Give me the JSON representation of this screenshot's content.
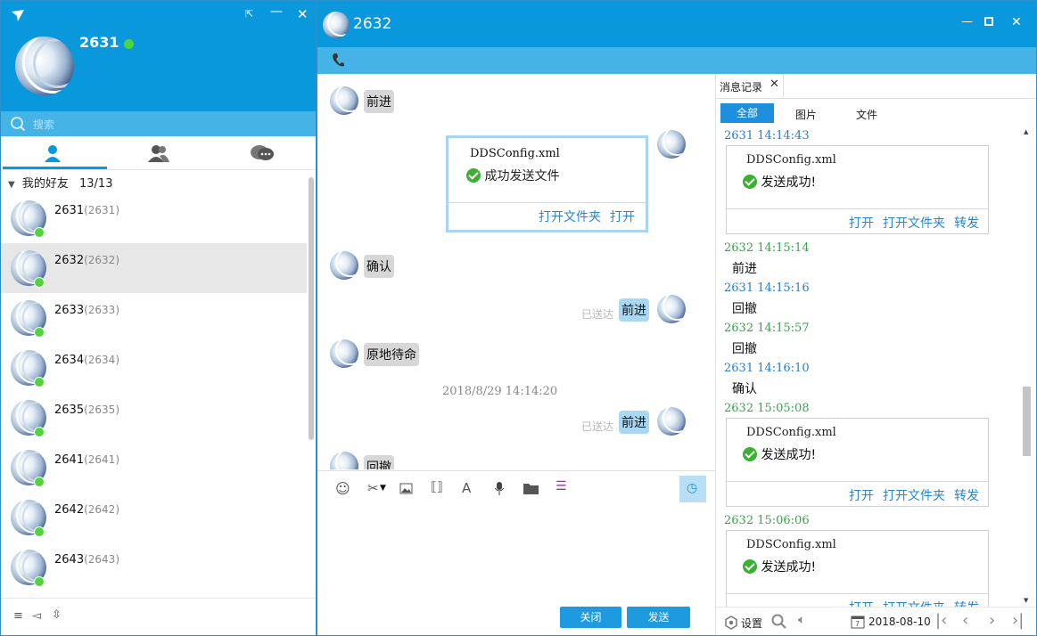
{
  "left": {
    "profile": {
      "name": "2631",
      "status_color": "#4fd43a"
    },
    "search": {
      "placeholder": "搜索"
    },
    "group": {
      "label": "我的好友",
      "count": "13/13"
    },
    "contacts": [
      {
        "name": "2631",
        "id": "(2631)"
      },
      {
        "name": "2632",
        "id": "(2632)"
      },
      {
        "name": "2633",
        "id": "(2633)"
      },
      {
        "name": "2634",
        "id": "(2634)"
      },
      {
        "name": "2635",
        "id": "(2635)"
      },
      {
        "name": "2641",
        "id": "(2641)"
      },
      {
        "name": "2642",
        "id": "(2642)"
      },
      {
        "name": "2643",
        "id": "(2643)"
      }
    ]
  },
  "chat": {
    "title": "2632",
    "messages": {
      "m1": "前进",
      "file_name": "DDSConfig.xml",
      "file_status": "成功发送文件",
      "open_folder": "打开文件夹",
      "open": "打开",
      "m2": "确认",
      "m3": "前进",
      "m3_status": "已送达",
      "m4": "原地待命",
      "time_sep": "2018/8/29 14:14:20",
      "m5": "前进",
      "m5_status": "已送达",
      "m6": "回撤"
    },
    "buttons": {
      "close": "关闭",
      "send": "发送"
    }
  },
  "history": {
    "tab_title": "消息记录",
    "filters": [
      "全部",
      "图片",
      "文件"
    ],
    "entries": {
      "e1_ts": "2631  14:14:43",
      "e1_file": "DDSConfig.xml",
      "e1_status": "发送成功!",
      "e2_ts": "2632  14:15:14",
      "e2_text": "前进",
      "e3_ts": "2631  14:15:16",
      "e3_text": "回撤",
      "e4_ts": "2632  14:15:57",
      "e4_text": "回撤",
      "e5_ts": "2631  14:16:10",
      "e5_text": "确认",
      "e6_ts": "2632  15:05:08",
      "e6_file": "DDSConfig.xml",
      "e6_status": "发送成功!",
      "e7_ts": "2632  15:06:06",
      "e7_file": "DDSConfig.xml",
      "e7_status": "发送成功!"
    },
    "links": {
      "open": "打开",
      "open_folder": "打开文件夹",
      "forward": "转发"
    },
    "footer": {
      "settings": "设置",
      "date": "2018-08-10"
    }
  },
  "colors": {
    "accent": "#0a98dc",
    "toolbar": "#46b3e6",
    "online": "#4fd43a",
    "link": "#2a86d0",
    "history_green": "#3aa34b",
    "history_blue": "#2a7ecb"
  }
}
